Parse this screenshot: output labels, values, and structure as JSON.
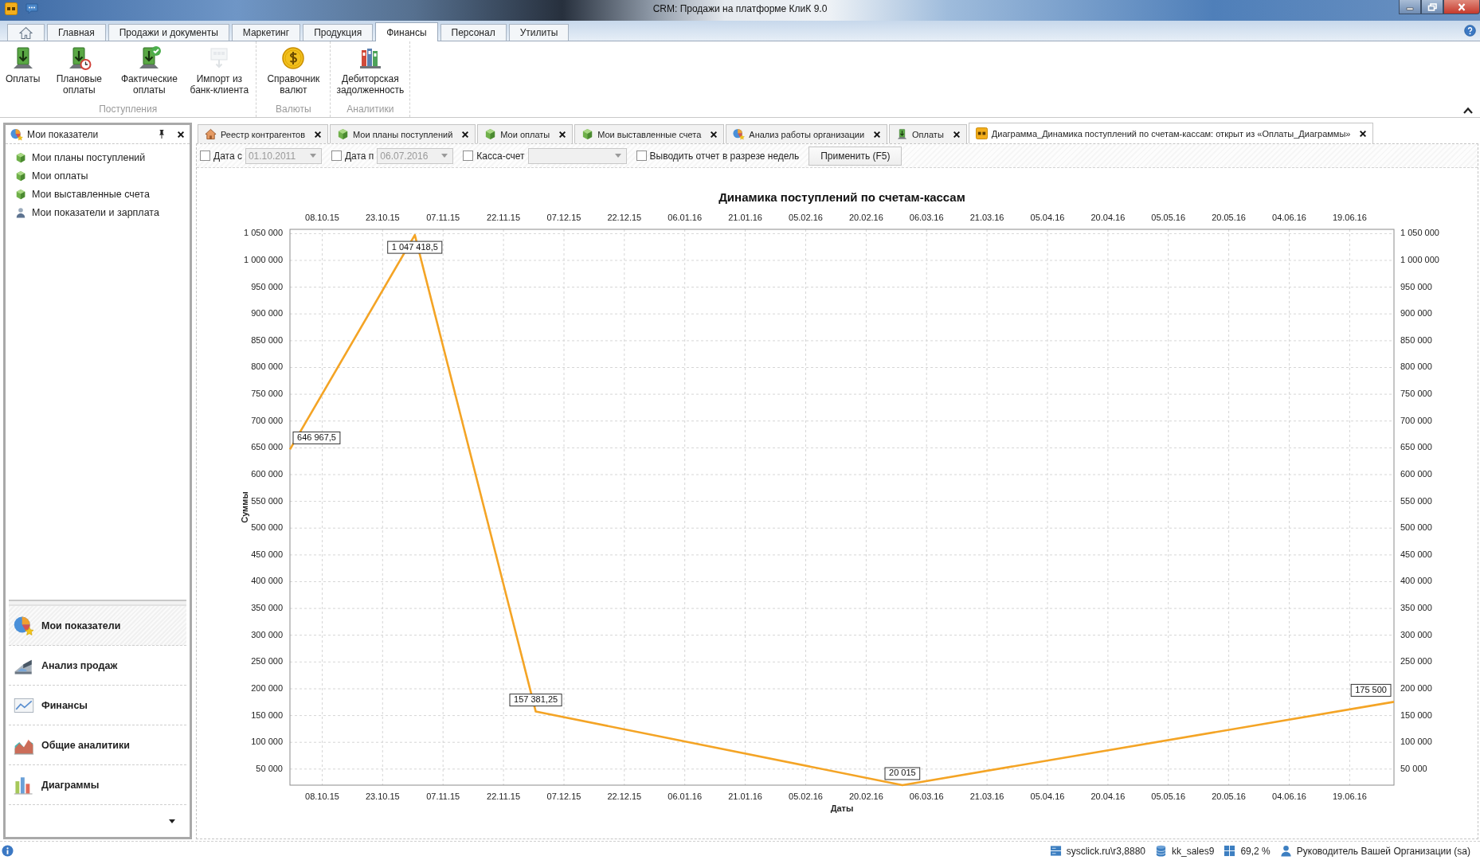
{
  "window": {
    "title": "CRM: Продажи на платформе КлиК 9.0"
  },
  "ribbon_tabs": [
    {
      "kind": "home",
      "selected": false
    },
    {
      "kind": "text",
      "label": "Главная",
      "selected": false
    },
    {
      "kind": "text",
      "label": "Продажи и документы",
      "selected": false
    },
    {
      "kind": "text",
      "label": "Маркетинг",
      "selected": false
    },
    {
      "kind": "text",
      "label": "Продукция",
      "selected": false
    },
    {
      "kind": "text",
      "label": "Финансы",
      "selected": true
    },
    {
      "kind": "text",
      "label": "Персонал",
      "selected": false
    },
    {
      "kind": "text",
      "label": "Утилиты",
      "selected": false
    }
  ],
  "ribbon_groups": [
    {
      "label": "Поступления",
      "buttons": [
        {
          "label": "Оплаты",
          "kind": "payments",
          "disabled": false
        },
        {
          "label": "Плановые оплаты",
          "kind": "planned",
          "disabled": false
        },
        {
          "label": "Фактические оплаты",
          "kind": "actual",
          "disabled": false
        },
        {
          "label": "Импорт из банк-клиента",
          "kind": "import",
          "disabled": true
        }
      ]
    },
    {
      "label": "Валюты",
      "buttons": [
        {
          "label": "Справочник валют",
          "kind": "currency",
          "disabled": false
        }
      ]
    },
    {
      "label": "Аналитики",
      "buttons": [
        {
          "label": "Дебиторская задолженность",
          "kind": "debt",
          "disabled": false
        }
      ]
    }
  ],
  "sidebar": {
    "title": "Мои показатели",
    "items": [
      {
        "label": "Мои планы поступлений",
        "kind": "cube"
      },
      {
        "label": "Мои оплаты",
        "kind": "cube"
      },
      {
        "label": "Мои выставленные счета",
        "kind": "cube"
      },
      {
        "label": "Мои показатели и зарплата",
        "kind": "person"
      }
    ],
    "sections": [
      {
        "label": "Мои показатели",
        "kind": "pie",
        "selected": true
      },
      {
        "label": "Анализ продаж",
        "kind": "slope",
        "selected": false
      },
      {
        "label": "Финансы",
        "kind": "line",
        "selected": false
      },
      {
        "label": "Общие аналитики",
        "kind": "area",
        "selected": false
      },
      {
        "label": "Диаграммы",
        "kind": "bars",
        "selected": false
      }
    ]
  },
  "document_tabs": [
    {
      "label": "Реестр контрагентов",
      "kind": "house",
      "selected": false
    },
    {
      "label": "Мои планы поступлений",
      "kind": "cube",
      "selected": false
    },
    {
      "label": "Мои оплаты",
      "kind": "cube",
      "selected": false
    },
    {
      "label": "Мои выставленные счета",
      "kind": "cube",
      "selected": false
    },
    {
      "label": "Анализ работы организации",
      "kind": "pie",
      "selected": false
    },
    {
      "label": "Оплаты",
      "kind": "payments",
      "selected": false
    },
    {
      "label": "Диаграмма_Динамика поступлений по счетам-кассам: открыт из «Оплаты_Диаграммы»",
      "kind": "app",
      "selected": true
    }
  ],
  "filters": [
    {
      "kind": "date",
      "label": "Дата с",
      "checked": false,
      "field": {
        "value": "01.10.2011",
        "disabled": true
      }
    },
    {
      "kind": "date",
      "label": "Дата п",
      "checked": false,
      "field": {
        "value": "06.07.2016",
        "disabled": true
      }
    },
    {
      "kind": "combo",
      "label": "Касса-счет",
      "checked": false,
      "field": {
        "disabled": true
      }
    },
    {
      "kind": "checkbox",
      "label": "Выводить отчет в разрезе недель",
      "checked": false
    }
  ],
  "apply_button": {
    "label": "Применить (F5)"
  },
  "chart": {
    "chart_data": {
      "type": "line",
      "title": "Динамика поступлений по счетам-кассам",
      "xlabel": "Даты",
      "ylabel": "Суммы",
      "grid": true,
      "x": [
        "2015-09-30",
        "2015-10-31",
        "2015-11-30",
        "2016-02-29",
        "2016-06-30"
      ],
      "series": [
        {
          "color": "#f4a425",
          "values": [
            646967.5,
            1047418.5,
            157381.25,
            20015,
            175500
          ]
        }
      ],
      "xlim": [
        "2015-09-30",
        "2016-06-30"
      ],
      "ylim": [
        20015,
        1058000
      ],
      "xticks": [
        {
          "value": "2015-10-08",
          "label": "08.10.15"
        },
        {
          "value": "2015-10-23",
          "label": "23.10.15"
        },
        {
          "value": "2015-11-07",
          "label": "07.11.15"
        },
        {
          "value": "2015-11-22",
          "label": "22.11.15"
        },
        {
          "value": "2015-12-07",
          "label": "07.12.15"
        },
        {
          "value": "2015-12-22",
          "label": "22.12.15"
        },
        {
          "value": "2016-01-06",
          "label": "06.01.16"
        },
        {
          "value": "2016-01-21",
          "label": "21.01.16"
        },
        {
          "value": "2016-02-05",
          "label": "05.02.16"
        },
        {
          "value": "2016-02-20",
          "label": "20.02.16"
        },
        {
          "value": "2016-03-06",
          "label": "06.03.16"
        },
        {
          "value": "2016-03-21",
          "label": "21.03.16"
        },
        {
          "value": "2016-04-05",
          "label": "05.04.16"
        },
        {
          "value": "2016-04-20",
          "label": "20.04.16"
        },
        {
          "value": "2016-05-05",
          "label": "05.05.16"
        },
        {
          "value": "2016-05-20",
          "label": "20.05.16"
        },
        {
          "value": "2016-06-04",
          "label": "04.06.16"
        },
        {
          "value": "2016-06-19",
          "label": "19.06.16"
        }
      ],
      "yticks": [
        {
          "value": 50000,
          "label": "50 000"
        },
        {
          "value": 100000,
          "label": "100 000"
        },
        {
          "value": 150000,
          "label": "150 000"
        },
        {
          "value": 200000,
          "label": "200 000"
        },
        {
          "value": 250000,
          "label": "250 000"
        },
        {
          "value": 300000,
          "label": "300 000"
        },
        {
          "value": 350000,
          "label": "350 000"
        },
        {
          "value": 400000,
          "label": "400 000"
        },
        {
          "value": 450000,
          "label": "450 000"
        },
        {
          "value": 500000,
          "label": "500 000"
        },
        {
          "value": 550000,
          "label": "550 000"
        },
        {
          "value": 600000,
          "label": "600 000"
        },
        {
          "value": 650000,
          "label": "650 000"
        },
        {
          "value": 700000,
          "label": "700 000"
        },
        {
          "value": 750000,
          "label": "750 000"
        },
        {
          "value": 800000,
          "label": "800 000"
        },
        {
          "value": 850000,
          "label": "850 000"
        },
        {
          "value": 900000,
          "label": "900 000"
        },
        {
          "value": 950000,
          "label": "950 000"
        },
        {
          "value": 1000000,
          "label": "1 000 000"
        },
        {
          "value": 1050000,
          "label": "1 050 000"
        }
      ],
      "value_labels": [
        "646 967,5",
        "1 047 418,5",
        "157 381,25",
        "20 015",
        "175 500"
      ]
    }
  },
  "status_bar": {
    "items": [
      {
        "kind": "server",
        "text": "sysclick.ru\\r3,8880"
      },
      {
        "kind": "database",
        "text": "kk_sales9"
      },
      {
        "kind": "tiles",
        "text": "69,2 %"
      },
      {
        "kind": "user",
        "text": "Руководитель Вашей Организации (sa)"
      }
    ]
  }
}
